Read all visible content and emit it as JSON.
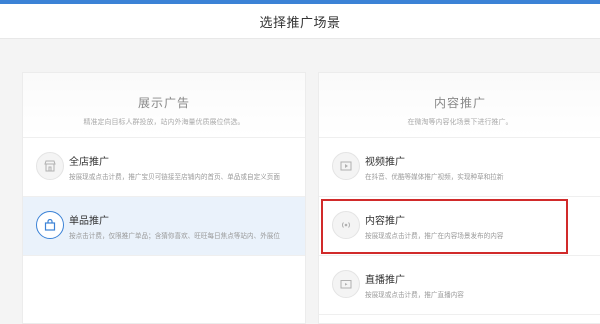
{
  "header": {
    "title": "选择推广场景"
  },
  "left_card": {
    "title": "展示广告",
    "subtitle": "精准定向目标人群投放，站内外海量优质展位供选。",
    "items": [
      {
        "name": "全店推广",
        "desc": "按展现或点击计费，推广宝贝可链接至店铺内的首页、单品或自定义页面",
        "icon": "store-icon",
        "selected": false
      },
      {
        "name": "单品推广",
        "desc": "按点击计费，仅限推广单品；含猜你喜欢、旺旺每日焦点等站内、外展位",
        "icon": "shopping-bag-icon",
        "selected": true
      }
    ]
  },
  "right_card": {
    "title": "内容推广",
    "subtitle": "在微淘等内容化场景下进行推广。",
    "items": [
      {
        "name": "视频推广",
        "desc": "在抖音、优酷等媒体推广视频，实现种草和拉新",
        "icon": "video-icon",
        "selected": false
      },
      {
        "name": "内容推广",
        "desc": "按展现或点击计费，推广在内容场景发布的内容",
        "icon": "broadcast-icon",
        "selected": false
      },
      {
        "name": "直播推广",
        "desc": "按展现或点击计费，推广直播内容",
        "icon": "live-icon",
        "selected": false
      }
    ]
  },
  "colors": {
    "accent": "#3b82d6",
    "highlight": "#d12a2a"
  }
}
